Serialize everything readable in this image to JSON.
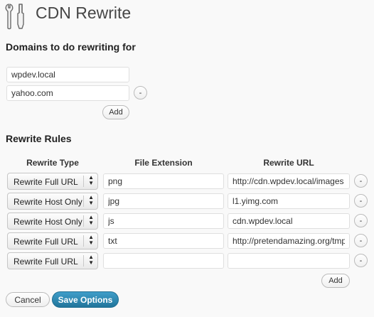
{
  "title": "CDN Rewrite",
  "icon": "tools-icon",
  "domains": {
    "heading": "Domains to do rewriting for",
    "items": [
      {
        "value": "wpdev.local"
      },
      {
        "value": "yahoo.com"
      }
    ],
    "remove_label": "-",
    "add_label": "Add"
  },
  "rules": {
    "heading": "Rewrite Rules",
    "columns": [
      "Rewrite Type",
      "File Extension",
      "Rewrite URL"
    ],
    "rows": [
      {
        "type": "Rewrite Full URL",
        "extension": "png",
        "url": "http://cdn.wpdev.local/images"
      },
      {
        "type": "Rewrite Host Only",
        "extension": "jpg",
        "url": "l1.yimg.com"
      },
      {
        "type": "Rewrite Host Only",
        "extension": "js",
        "url": "cdn.wpdev.local"
      },
      {
        "type": "Rewrite Full URL",
        "extension": "txt",
        "url": "http://pretendamazing.org/tmp"
      },
      {
        "type": "Rewrite Full URL",
        "extension": "",
        "url": ""
      }
    ],
    "remove_label": "-",
    "add_label": "Add"
  },
  "buttons": {
    "cancel": "Cancel",
    "save": "Save Options"
  },
  "colors": {
    "primary": "#21759b",
    "background": "#f9f9f9"
  }
}
